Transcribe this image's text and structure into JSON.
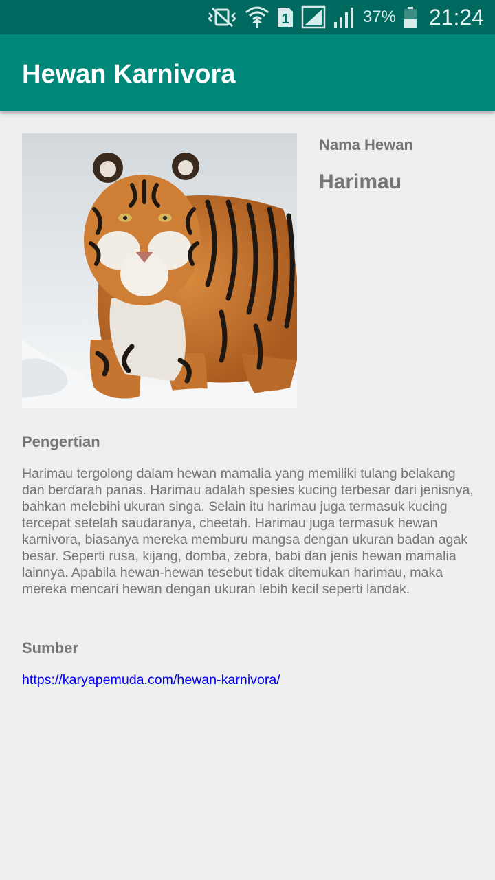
{
  "status_bar": {
    "icons": [
      "vibrate-mute-icon",
      "wifi-icon",
      "sim-1-icon",
      "signal-sim1-icon",
      "signal-sim2-icon",
      "battery-icon"
    ],
    "battery_percent": "37%",
    "time": "21:24"
  },
  "app_bar": {
    "title": "Hewan Karnivora",
    "color": "#00897b",
    "status_color": "#00695f"
  },
  "animal": {
    "image_icon": "tiger-photo",
    "name_label": "Nama Hewan",
    "name": "Harimau"
  },
  "definition": {
    "heading": "Pengertian",
    "text": "Harimau tergolong dalam hewan mamalia yang memiliki tulang belakang dan berdarah panas. Harimau adalah spesies kucing terbesar dari jenisnya, bahkan melebihi ukuran singa. Selain itu harimau juga termasuk kucing tercepat setelah saudaranya, cheetah. Harimau juga termasuk hewan karnivora, biasanya mereka memburu mangsa dengan ukuran badan agak besar. Seperti rusa, kijang, domba, zebra, babi dan jenis hewan mamalia lainnya. Apabila hewan-hewan tesebut tidak ditemukan harimau, maka mereka mencari hewan dengan ukuran lebih kecil seperti landak."
  },
  "source": {
    "heading": "Sumber",
    "link": "https://karyapemuda.com/hewan-karnivora/"
  }
}
